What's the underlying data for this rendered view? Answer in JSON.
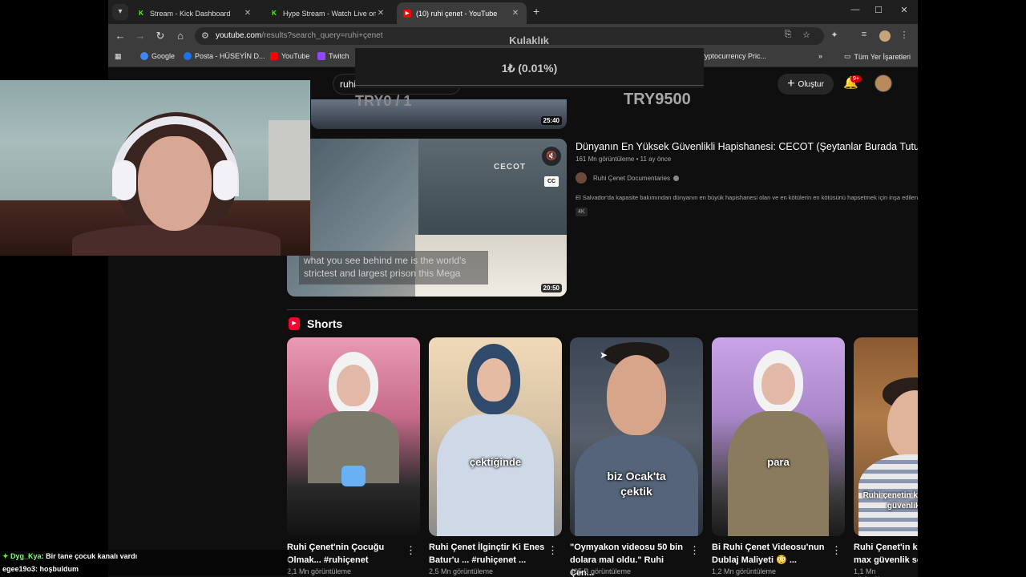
{
  "browser": {
    "tabs": [
      {
        "title": "Stream - Kick Dashboard",
        "favicon": "kick-icon",
        "active": false
      },
      {
        "title": "Hype Stream - Watch Live on Ki",
        "favicon": "kick-icon",
        "active": false
      },
      {
        "title": "(10) ruhi çenet - YouTube",
        "favicon": "youtube-icon",
        "active": true
      }
    ],
    "url_host": "youtube.com",
    "url_path": "/results?search_query=ruhi+çenet",
    "bookmarks": [
      {
        "label": "Google",
        "color": "#4285f4"
      },
      {
        "label": "Posta - HÜSEYİN D...",
        "color": "#1a73e8"
      },
      {
        "label": "YouTube",
        "color": "#ff0000"
      },
      {
        "label": "Twitch",
        "color": "#9146ff"
      },
      {
        "label": "ryptocurrency Pric...",
        "color": "#3c3c3c"
      }
    ],
    "bookmarks_more": "»",
    "all_bookmarks": "Tüm Yer İşaretleri"
  },
  "youtube": {
    "search_value": "ruhi",
    "create_label": "Oluştur",
    "notification_count": "9+"
  },
  "overlay": {
    "product": "Kulaklık",
    "price": "1₺ (0.01%)",
    "try_left": "TRY0 / 1",
    "try_right": "TRY9500"
  },
  "results": {
    "top_video_duration": "25:40",
    "video": {
      "title": "Dünyanın En Yüksek Güvenlikli Hapishanesi: CECOT (Şeytanlar Burada Tutuluyor)",
      "meta": "161 Mn görüntüleme • 11 ay önce",
      "channel": "Ruhi Çenet Documentaries",
      "description": "El Salvador'da kapasite bakımından dünyanın en büyük hapishanesi olan ve en kötülerin en kötüsünü hapsetmek için inşa edilen ...",
      "badge": "4K",
      "duration": "20:50",
      "caption": "what you see behind me is the world's strictest and largest prison this Mega",
      "cc_label": "CC",
      "thumb_logo": "CECOT"
    }
  },
  "shorts": {
    "section_title": "Shorts",
    "items": [
      {
        "title": "Ruhi Çenet'nin Çocuğu Olmak... #ruhiçenet",
        "views": "2,1 Mn görüntüleme",
        "caption": ""
      },
      {
        "title": "Ruhi Çenet İlginçtir Ki Enes Batur'u ... #ruhiçenet ...",
        "views": "2,5 Mn görüntüleme",
        "caption": "çektiğinde"
      },
      {
        "title": "\"Oymyakon videosu 50 bin dolara mal oldu.\" Ruhi Çen...",
        "views": "405 B görüntüleme",
        "caption": "biz Ocak'ta çektik"
      },
      {
        "title": "Bi Ruhi Çenet Videosu'nun Dublaj Maliyeti 😳 ...",
        "views": "1,2 Mn görüntüleme",
        "caption": "para"
      },
      {
        "title": "Ruhi Çenet'in kanalındaki max güvenlik seviyesi #ru...",
        "views": "1,1 Mn görüntüleme",
        "caption": "Ruhi çenetin kanalinda ki max güvenlik seviyesi"
      }
    ]
  },
  "chat": [
    {
      "user": "Dyg_Kya",
      "message": "Bir tane çocuk kanalı vardı"
    },
    {
      "user": "egee19o3",
      "message": "hoşbuldum"
    }
  ]
}
